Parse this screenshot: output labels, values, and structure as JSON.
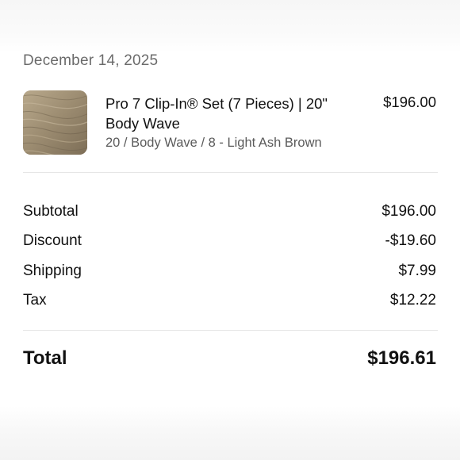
{
  "order": {
    "date": "December 14, 2025"
  },
  "item": {
    "image_icon": "hair-swatch-thumbnail",
    "name": "Pro 7 Clip-In® Set (7 Pieces) | 20\" Body Wave",
    "variant": "20 / Body Wave / 8 - Light Ash Brown",
    "price": "$196.00"
  },
  "summary": {
    "subtotal_label": "Subtotal",
    "subtotal_value": "$196.00",
    "discount_label": "Discount",
    "discount_value": "-$19.60",
    "shipping_label": "Shipping",
    "shipping_value": "$7.99",
    "tax_label": "Tax",
    "tax_value": "$12.22",
    "total_label": "Total",
    "total_value": "$196.61"
  },
  "colors": {
    "thumbnail_base": "#9a8a70",
    "secondary_text": "#6b6b6b",
    "divider": "#e6e6e6"
  }
}
